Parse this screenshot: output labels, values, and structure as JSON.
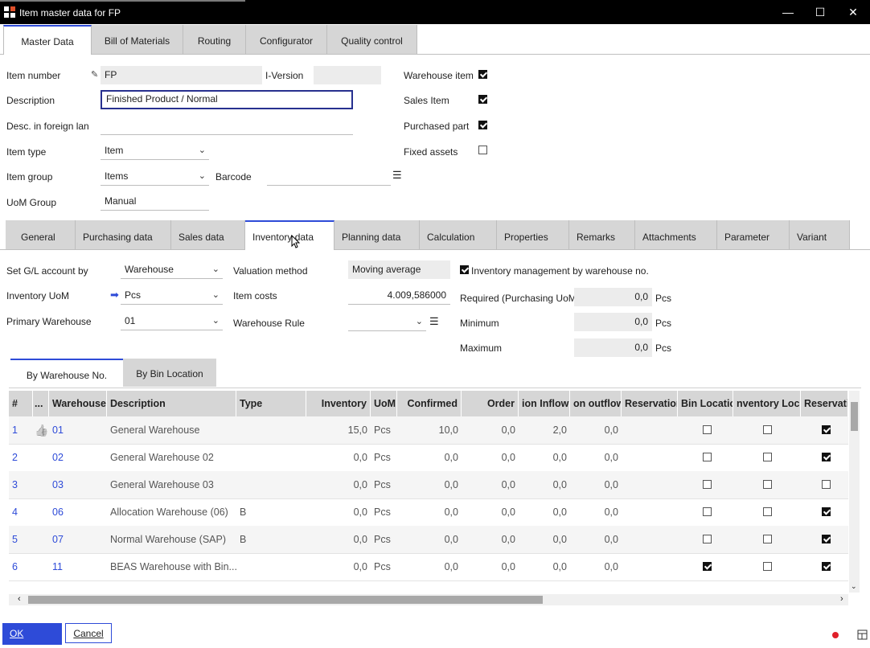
{
  "window": {
    "title": "Item master data for FP",
    "minimize": "—",
    "maximize": "☐",
    "close": "✕"
  },
  "top_tabs": [
    "Master Data",
    "Bill of Materials",
    "Routing",
    "Configurator",
    "Quality control"
  ],
  "header": {
    "item_number_label": "Item number",
    "item_number": "FP",
    "iversion_label": "I-Version",
    "iversion": "",
    "description_label": "Description",
    "description": "Finished Product / Normal",
    "foreign_label": "Desc. in foreign lan",
    "foreign": "",
    "item_type_label": "Item type",
    "item_type": "Item",
    "item_group_label": "Item group",
    "item_group": "Items",
    "barcode_label": "Barcode",
    "barcode": "",
    "uom_group_label": "UoM Group",
    "uom_group": "Manual",
    "warehouse_item_label": "Warehouse item",
    "sales_item_label": "Sales Item",
    "purchased_part_label": "Purchased part",
    "fixed_assets_label": "Fixed assets"
  },
  "sub_tabs": [
    "General",
    "Purchasing data",
    "Sales data",
    "Inventory data",
    "Planning data",
    "Calculation",
    "Properties",
    "Remarks",
    "Attachments",
    "Parameter",
    "Variant"
  ],
  "inventory": {
    "gl_label": "Set G/L account by",
    "gl_value": "Warehouse",
    "uom_label": "Inventory UoM",
    "uom_value": "Pcs",
    "primary_wh_label": "Primary Warehouse",
    "primary_wh_value": "01",
    "valuation_label": "Valuation method",
    "valuation_value": "Moving average",
    "item_costs_label": "Item costs",
    "item_costs_value": "4.009,586000",
    "wh_rule_label": "Warehouse Rule",
    "wh_rule_value": "",
    "mgmt_label": "Inventory management by warehouse no.",
    "required_label": "Required (Purchasing UoM)",
    "required_value": "0,0",
    "minimum_label": "Minimum",
    "minimum_value": "0,0",
    "maximum_label": "Maximum",
    "maximum_value": "0,0",
    "unit": "Pcs"
  },
  "bottom_tabs": [
    "By Warehouse No.",
    "By Bin Location"
  ],
  "grid": {
    "columns": [
      "#",
      "...",
      "Warehouse",
      "Description",
      "Type",
      "Inventory",
      "UoM",
      "Confirmed",
      "Order",
      "ion Inflow",
      "on outflow",
      "Reservation",
      "Bin Location",
      "nventory Locke",
      "Reservatio"
    ],
    "rows": [
      {
        "n": "1",
        "wh": "01",
        "desc": "General Warehouse",
        "type": "",
        "inv": "15,0",
        "uom": "Pcs",
        "conf": "10,0",
        "order": "0,0",
        "inflow": "2,0",
        "outflow": "0,0",
        "bin": false,
        "locked": false,
        "res": true
      },
      {
        "n": "2",
        "wh": "02",
        "desc": "General Warehouse 02",
        "type": "",
        "inv": "0,0",
        "uom": "Pcs",
        "conf": "0,0",
        "order": "0,0",
        "inflow": "0,0",
        "outflow": "0,0",
        "bin": false,
        "locked": false,
        "res": true
      },
      {
        "n": "3",
        "wh": "03",
        "desc": "General Warehouse 03",
        "type": "",
        "inv": "0,0",
        "uom": "Pcs",
        "conf": "0,0",
        "order": "0,0",
        "inflow": "0,0",
        "outflow": "0,0",
        "bin": false,
        "locked": false,
        "res": false
      },
      {
        "n": "4",
        "wh": "06",
        "desc": "Allocation Warehouse (06)",
        "type": "B",
        "inv": "0,0",
        "uom": "Pcs",
        "conf": "0,0",
        "order": "0,0",
        "inflow": "0,0",
        "outflow": "0,0",
        "bin": false,
        "locked": false,
        "res": true
      },
      {
        "n": "5",
        "wh": "07",
        "desc": "Normal Warehouse (SAP)",
        "type": "B",
        "inv": "0,0",
        "uom": "Pcs",
        "conf": "0,0",
        "order": "0,0",
        "inflow": "0,0",
        "outflow": "0,0",
        "bin": false,
        "locked": false,
        "res": true
      },
      {
        "n": "6",
        "wh": "11",
        "desc": "BEAS Warehouse with Bin...",
        "type": "",
        "inv": "0,0",
        "uom": "Pcs",
        "conf": "0,0",
        "order": "0,0",
        "inflow": "0,0",
        "outflow": "0,0",
        "bin": true,
        "locked": false,
        "res": true
      }
    ]
  },
  "footer": {
    "ok": "OK",
    "cancel": "Cancel"
  },
  "colors": {
    "accent": "#2e4bd8",
    "tab_bg": "#d6d6d6",
    "status_dot": "#e0202a"
  }
}
